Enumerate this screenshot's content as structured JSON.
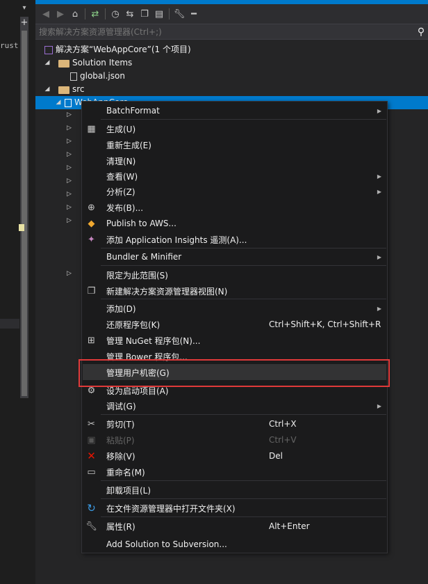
{
  "left_code": {
    "snippet": "rust"
  },
  "toolbar": {
    "buttons": [
      "back-icon",
      "forward-icon",
      "home-icon",
      "sync-icon",
      "history-icon",
      "switch-views-icon",
      "collapse-all-icon",
      "show-all-files-icon",
      "properties-icon",
      "pin-icon"
    ]
  },
  "search": {
    "placeholder": "搜索解决方案资源管理器(Ctrl+;)"
  },
  "tree": {
    "solution": "解决方案“WebAppCore”(1 个项目)",
    "solution_items": "Solution Items",
    "global_json": "global.json",
    "src": "src",
    "project": "WebAppCore"
  },
  "menu": {
    "items": [
      {
        "label": "BatchFormat",
        "submenu": true
      },
      {
        "label": "生成(U)"
      },
      {
        "label": "重新生成(E)"
      },
      {
        "label": "清理(N)"
      },
      {
        "label": "查看(W)",
        "submenu": true
      },
      {
        "label": "分析(Z)",
        "submenu": true
      },
      {
        "label": "发布(B)..."
      },
      {
        "label": "Publish to AWS..."
      },
      {
        "label": "添加 Application Insights 遥测(A)..."
      },
      {
        "label": "Bundler & Minifier",
        "submenu": true
      },
      {
        "label": "限定为此范围(S)"
      },
      {
        "label": "新建解决方案资源管理器视图(N)"
      },
      {
        "label": "添加(D)",
        "submenu": true
      },
      {
        "label": "还原程序包(K)",
        "shortcut": "Ctrl+Shift+K, Ctrl+Shift+R"
      },
      {
        "label": "管理 NuGet 程序包(N)..."
      },
      {
        "label": "管理 Bower 程序包..."
      },
      {
        "label": "管理用户机密(G)"
      },
      {
        "label": "设为启动项目(A)"
      },
      {
        "label": "调试(G)",
        "submenu": true
      },
      {
        "label": "剪切(T)",
        "shortcut": "Ctrl+X"
      },
      {
        "label": "粘贴(P)",
        "shortcut": "Ctrl+V",
        "disabled": true
      },
      {
        "label": "移除(V)",
        "shortcut": "Del"
      },
      {
        "label": "重命名(M)"
      },
      {
        "label": "卸载项目(L)"
      },
      {
        "label": "在文件资源管理器中打开文件夹(X)"
      },
      {
        "label": "属性(R)",
        "shortcut": "Alt+Enter"
      },
      {
        "label": "Add Solution to Subversion..."
      }
    ]
  },
  "colors": {
    "accent": "#007acc",
    "highlight_border": "#e03a3a",
    "menu_bg": "#1b1b1c"
  }
}
